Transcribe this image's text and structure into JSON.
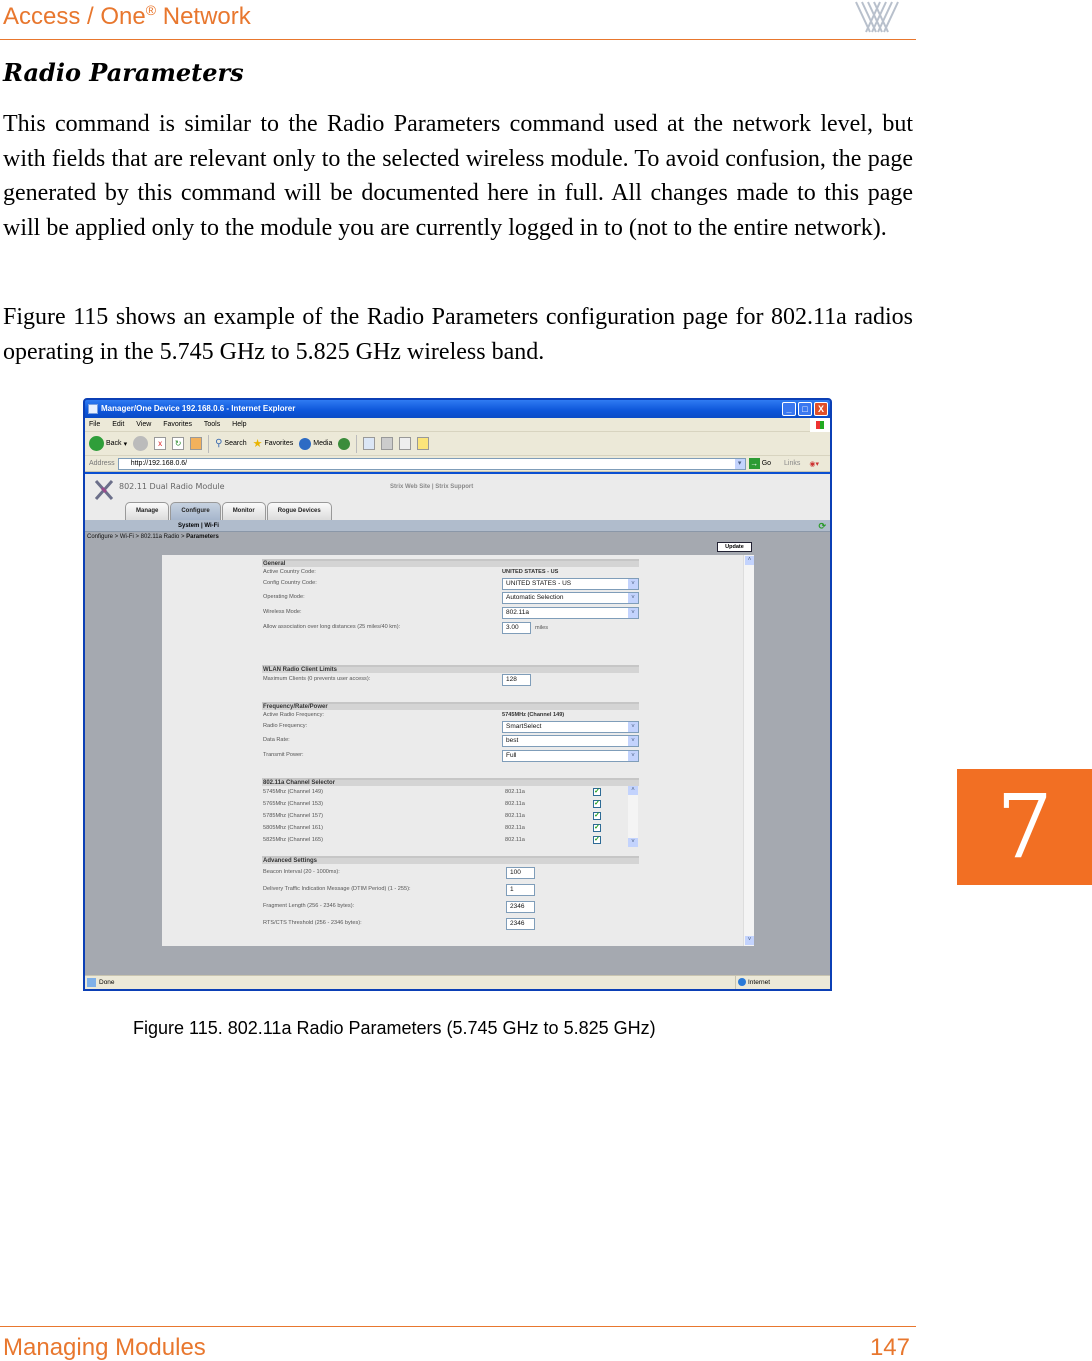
{
  "header": {
    "title": "Access / One",
    "title_sup": "®",
    "title_suffix": " Network",
    "logo": "strix-logo-icon"
  },
  "section": {
    "title": "Radio Parameters",
    "para1": "This command is similar to the Radio Parameters command used at the network level, but with fields that are relevant only to the selected wireless module. To avoid confusion, the page generated by this command will be documented here in full. All changes made to this page will be applied only to the module you are currently logged in to (not to the entire network).",
    "para2": "Figure 115 shows an example of the Radio Parameters configuration page for 802.11a radios operating in the 5.745 GHz to 5.825 GHz wireless band."
  },
  "chapter_tab": "7",
  "browser": {
    "window_title": "Manager/One Device 192.168.0.6 - Internet Explorer",
    "window_buttons": [
      "_",
      "□",
      "X"
    ],
    "menu": [
      "File",
      "Edit",
      "View",
      "Favorites",
      "Tools",
      "Help"
    ],
    "toolbar": {
      "back": "Back",
      "search": "Search",
      "favorites": "Favorites",
      "media": "Media"
    },
    "address_label": "Address",
    "address_value": "http://192.168.0.6/",
    "go_label": "Go",
    "links_label": "Links",
    "status_text": "Done",
    "zone_text": "Internet"
  },
  "app": {
    "name": "802.11 Dual Radio Module",
    "links": "Strix Web Site  |  Strix Support",
    "tabs": [
      {
        "label": "Manage",
        "active": false
      },
      {
        "label": "Configure",
        "active": true
      },
      {
        "label": "Monitor",
        "active": false
      },
      {
        "label": "Rogue Devices",
        "active": false
      }
    ],
    "subnav": "System  |  Wi-Fi",
    "breadcrumb": "Configure > Wi-Fi > 802.11a Radio > ",
    "breadcrumb_current": "Parameters",
    "update_button": "Update"
  },
  "form": {
    "general": {
      "heading": "General",
      "active_country_label": "Active Country Code:",
      "active_country_value": "UNITED STATES - US",
      "config_country_label": "Config Country Code:",
      "config_country_value": "UNITED STATES - US",
      "operating_mode_label": "Operating Mode:",
      "operating_mode_value": "Automatic Selection",
      "wireless_mode_label": "Wireless Mode:",
      "wireless_mode_value": "802.11a",
      "long_distance_label": "Allow association over long distances (25 miles/40 km):",
      "long_distance_value": "3.00",
      "long_distance_unit": "miles"
    },
    "client_limits": {
      "heading": "WLAN Radio Client Limits",
      "max_clients_label": "Maximum Clients (0 prevents user access):",
      "max_clients_value": "128"
    },
    "freq": {
      "heading": "Frequency/Rate/Power",
      "active_freq_label": "Active Radio Frequency:",
      "active_freq_value": "5745MHz (Channel 149)",
      "radio_freq_label": "Radio Frequency:",
      "radio_freq_value": "SmartSelect",
      "data_rate_label": "Data Rate:",
      "data_rate_value": "best",
      "tx_power_label": "Transmit Power:",
      "tx_power_value": "Full"
    },
    "channels": {
      "heading": "802.11a Channel Selector",
      "rows": [
        {
          "freq": "5745Mhz (Channel 149)",
          "mode": "802.11a",
          "checked": true
        },
        {
          "freq": "5765Mhz (Channel 153)",
          "mode": "802.11a",
          "checked": true
        },
        {
          "freq": "5785Mhz (Channel 157)",
          "mode": "802.11a",
          "checked": true
        },
        {
          "freq": "5805Mhz (Channel 161)",
          "mode": "802.11a",
          "checked": true
        },
        {
          "freq": "5825Mhz (Channel 165)",
          "mode": "802.11a",
          "checked": true
        }
      ]
    },
    "advanced": {
      "heading": "Advanced Settings",
      "beacon_label": "Beacon Interval (20 - 1000ms):",
      "beacon_value": "100",
      "dtim_label": "Delivery Traffic Indication Message (DTIM Period) (1 - 255):",
      "dtim_value": "1",
      "frag_label": "Fragment Length (256 - 2346 bytes):",
      "frag_value": "2346",
      "rts_label": "RTS/CTS Threshold (256 - 2346 bytes):",
      "rts_value": "2346"
    }
  },
  "caption": "Figure 115. 802.11a Radio Parameters (5.745 GHz to 5.825 GHz)",
  "footer": {
    "left": "Managing Modules",
    "page_number": "147"
  }
}
